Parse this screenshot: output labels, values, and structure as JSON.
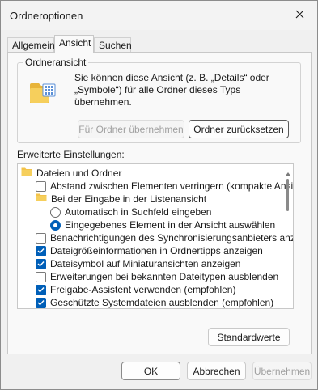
{
  "window": {
    "title": "Ordneroptionen"
  },
  "tabs": [
    {
      "label": "Allgemein"
    },
    {
      "label": "Ansicht"
    },
    {
      "label": "Suchen"
    }
  ],
  "folder_view": {
    "legend": "Ordneransicht",
    "description": "Sie können diese Ansicht (z. B. „Details“ oder „Symbole“) für alle Ordner dieses Typs übernehmen.",
    "apply_button": "Für Ordner übernehmen",
    "reset_button": "Ordner zurücksetzen"
  },
  "advanced": {
    "label": "Erweiterte Einstellungen:",
    "items": [
      {
        "type": "folder",
        "text": "Dateien und Ordner"
      },
      {
        "type": "checkbox",
        "checked": false,
        "text": "Abstand zwischen Elementen verringern (kompakte Ansicht)"
      },
      {
        "type": "folder",
        "text": "Bei der Eingabe in der Listenansicht"
      },
      {
        "type": "radio",
        "checked": false,
        "text": "Automatisch in Suchfeld eingeben"
      },
      {
        "type": "radio",
        "checked": true,
        "text": "Eingegebenes Element in der Ansicht auswählen"
      },
      {
        "type": "checkbox",
        "checked": false,
        "text": "Benachrichtigungen des Synchronisierungsanbieters anzeigen"
      },
      {
        "type": "checkbox",
        "checked": true,
        "text": "Dateigrößeinformationen in Ordnertipps anzeigen"
      },
      {
        "type": "checkbox",
        "checked": true,
        "text": "Dateisymbol auf Miniaturansichten anzeigen"
      },
      {
        "type": "checkbox",
        "checked": false,
        "text": "Erweiterungen bei bekannten Dateitypen ausblenden"
      },
      {
        "type": "checkbox",
        "checked": true,
        "text": "Freigabe-Assistent verwenden (empfohlen)"
      },
      {
        "type": "checkbox",
        "checked": true,
        "text": "Geschützte Systemdateien ausblenden (empfohlen)"
      }
    ],
    "highlight_color": "#fdf24d",
    "defaults_button": "Standardwerte"
  },
  "footer": {
    "ok": "OK",
    "cancel": "Abbrechen",
    "apply": "Übernehmen"
  },
  "colors": {
    "accent": "#005fb8",
    "folder": "#f3c34a"
  }
}
